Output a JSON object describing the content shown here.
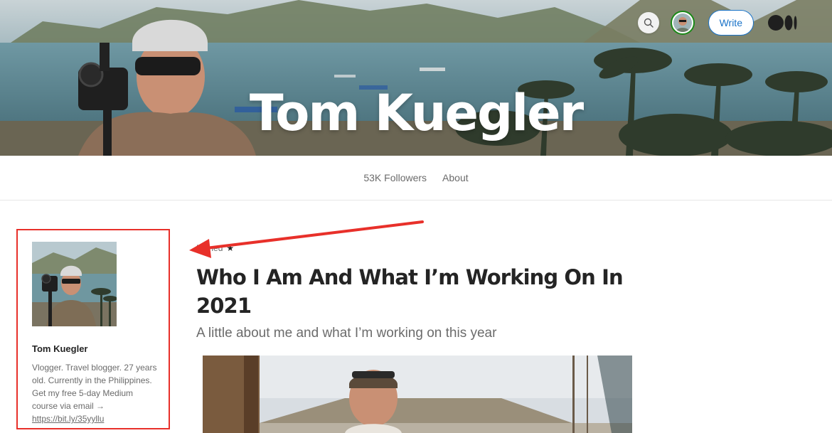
{
  "profile": {
    "name": "Tom Kuegler"
  },
  "header": {
    "write_label": "Write",
    "search_icon": "search-icon",
    "logo_icon": "medium-logo-icon",
    "accent_color": "#1a73c8"
  },
  "nav": {
    "followers_label": "53K Followers",
    "about_label": "About"
  },
  "sidebar": {
    "name": "Tom Kuegler",
    "bio": "Vlogger. Travel blogger. 27 years old. Currently in the Philippines. Get my free 5-day Medium course via email →",
    "link_text": "https://bit.ly/35yyllu",
    "highlight_color": "#e8302a"
  },
  "article": {
    "pinned_label": "Pinned",
    "pinned_icon": "star-icon",
    "title": "Who I Am And What I’m Working On In 2021",
    "subtitle": "A little about me and what I’m working on this year"
  },
  "annotation": {
    "arrow_color": "#e8302a"
  }
}
